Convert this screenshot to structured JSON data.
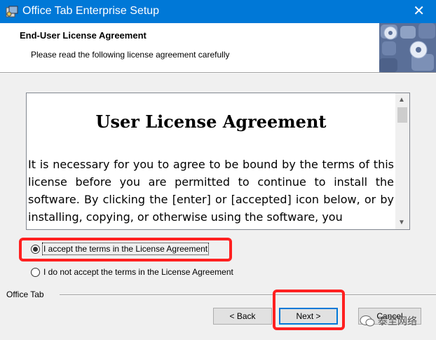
{
  "window": {
    "title": "Office Tab Enterprise Setup",
    "close_glyph": "✕"
  },
  "header": {
    "title": "End-User License Agreement",
    "subtitle": "Please read the following license agreement carefully"
  },
  "license": {
    "heading": "User License Agreement",
    "body": "It is necessary for you to agree to be bound by the terms of this license before you are permitted to continue to install the software. By clicking the [enter] or [accepted] icon below, or by installing, copying, or otherwise using the software, you",
    "scroll_up": "▲",
    "scroll_down": "▼"
  },
  "options": {
    "accept_label": "I accept the terms in the License Agreement",
    "decline_label": "I do not accept the terms in the License Agreement",
    "selected": "accept"
  },
  "footer": {
    "brand_label": "Office Tab",
    "back_label": "< Back",
    "next_label": "Next >",
    "cancel_label": "Cancel"
  },
  "overlay": {
    "watermark_text": "泰至网络"
  },
  "colors": {
    "titlebar": "#0078d7",
    "highlight": "#ff2020",
    "default_button_border": "#0078d7"
  }
}
